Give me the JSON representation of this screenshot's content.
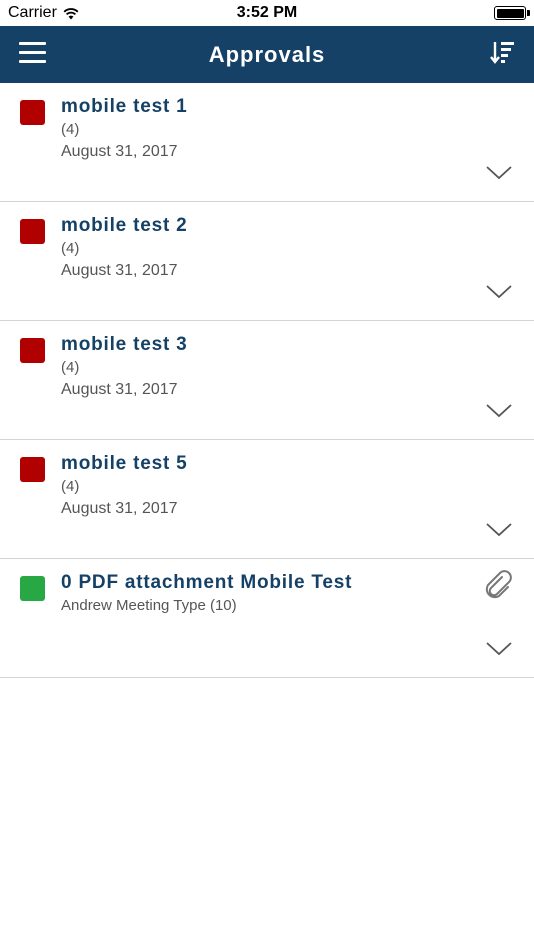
{
  "status_bar": {
    "carrier": "Carrier",
    "time": "3:52 PM"
  },
  "nav": {
    "title": "Approvals",
    "menu_icon": "hamburger-menu-icon",
    "sort_icon": "sort-icon",
    "background": "#154166"
  },
  "colors": {
    "red": "#b00000",
    "green": "#28a745",
    "title": "#154166"
  },
  "items": [
    {
      "title": "mobile test 1",
      "subtitle": "(4)",
      "date": "August 31, 2017",
      "status": "red"
    },
    {
      "title": "mobile test 2",
      "subtitle": "(4)",
      "date": "August 31, 2017",
      "status": "red"
    },
    {
      "title": "mobile test 3",
      "subtitle": "(4)",
      "date": "August 31, 2017",
      "status": "red"
    },
    {
      "title": "mobile test 5",
      "subtitle": "(4)",
      "date": "August 31, 2017",
      "status": "red"
    },
    {
      "title": "0 PDF attachment Mobile Test",
      "subtitle": "Andrew Meeting Type (10)",
      "date": "",
      "status": "green",
      "has_attachment": true
    }
  ]
}
